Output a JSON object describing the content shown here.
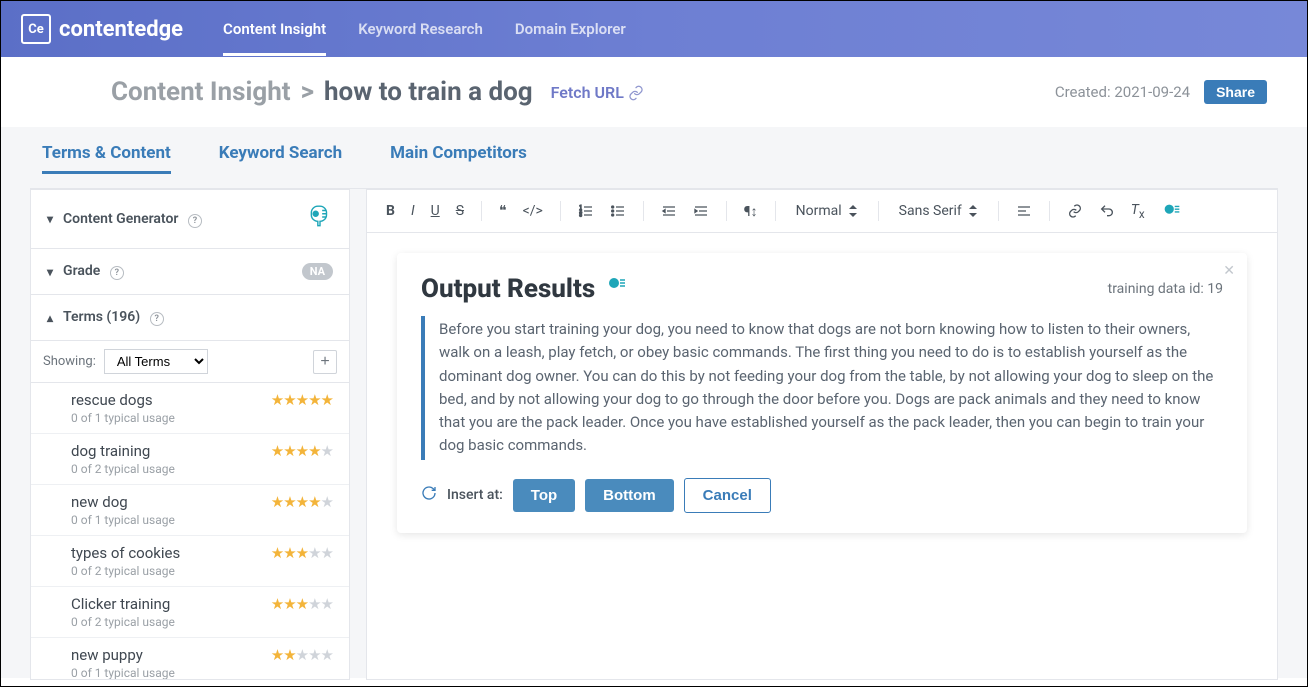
{
  "brand": "contentedge",
  "logo_text": "Ce",
  "topnav": [
    {
      "label": "Content Insight",
      "active": true
    },
    {
      "label": "Keyword Research",
      "active": false
    },
    {
      "label": "Domain Explorer",
      "active": false
    }
  ],
  "breadcrumb": {
    "section": "Content Insight",
    "sep": ">",
    "query": "how to train a dog"
  },
  "fetch_url_label": "Fetch URL",
  "created_label": "Created:",
  "created_date": "2021-09-24",
  "share_label": "Share",
  "section_tabs": [
    {
      "label": "Terms & Content",
      "active": true
    },
    {
      "label": "Keyword Search",
      "active": false
    },
    {
      "label": "Main Competitors",
      "active": false
    }
  ],
  "sidebar": {
    "content_gen_label": "Content Generator",
    "grade_label": "Grade",
    "grade_badge": "NA",
    "terms_label": "Terms (196)",
    "showing_label": "Showing:",
    "filter_options": [
      "All Terms"
    ],
    "filter_selected": "All Terms",
    "terms": [
      {
        "term": "rescue dogs",
        "usage": "0 of 1 typical usage",
        "stars": 5
      },
      {
        "term": "dog training",
        "usage": "0 of 2 typical usage",
        "stars": 4
      },
      {
        "term": "new dog",
        "usage": "0 of 1 typical usage",
        "stars": 4
      },
      {
        "term": "types of cookies",
        "usage": "0 of 2 typical usage",
        "stars": 3
      },
      {
        "term": "Clicker training",
        "usage": "0 of 2 typical usage",
        "stars": 3
      },
      {
        "term": "new puppy",
        "usage": "0 of 1 typical usage",
        "stars": 2
      }
    ]
  },
  "editor": {
    "format_normal": "Normal",
    "font_family": "Sans Serif"
  },
  "output": {
    "title": "Output Results",
    "meta_prefix": "training data id:",
    "meta_id": "19",
    "body": "Before you start training your dog, you need to know that dogs are not born knowing how to listen to their owners, walk on a leash, play fetch, or obey basic commands. The first thing you need to do is to establish yourself as the dominant dog owner. You can do this by not feeding your dog from the table, by not allowing your dog to sleep on the bed, and by not allowing your dog to go through the door before you. Dogs are pack animals and they need to know that you are the pack leader. Once you have established yourself as the pack leader, then you can begin to train your dog basic commands.",
    "insert_label": "Insert at:",
    "btn_top": "Top",
    "btn_bottom": "Bottom",
    "btn_cancel": "Cancel"
  }
}
